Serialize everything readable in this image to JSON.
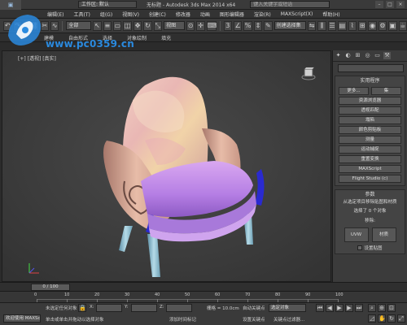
{
  "titlebar": {
    "workspace": "工作区: 默认",
    "document": "无标题 - Autodesk 3ds Max 2014 x64",
    "search_placeholder": "键入关键字或短语"
  },
  "menus": [
    "编辑(E)",
    "工具(T)",
    "组(G)",
    "视图(V)",
    "创建(C)",
    "修改器",
    "动画",
    "图形编辑器",
    "渲染(R)",
    "MAXScript(X)",
    "帮助(H)"
  ],
  "toolbar": {
    "selection_filter": "全部",
    "reference_coord": "视图",
    "named_selection": "创建选择集"
  },
  "ribbon": {
    "tabs": [
      "建模",
      "自由形式",
      "选择",
      "对象绘制",
      "填充"
    ]
  },
  "watermark": {
    "text": "www.pc0359.cn"
  },
  "viewport": {
    "label": "[+] [透视] [真实]"
  },
  "command_panel": {
    "rollout_title": "实用程序",
    "top_buttons": [
      "更多...",
      "集"
    ],
    "utilities": [
      "资源浏览器",
      "透视匹配",
      "塌陷",
      "颜色剪贴板",
      "测量",
      "运动捕捉",
      "重置变换",
      "MAXScript",
      "Flight Studio (c)"
    ],
    "params_title": "参数",
    "params_desc": "从选定项目移除贴图和材质",
    "selected_info": "选择了 0 个对象",
    "remove_label": "移除:",
    "uvw_button": "UVW",
    "material_button": "材质",
    "checkbox_label": "设置贴图"
  },
  "timeline": {
    "slider": "0 / 100",
    "ticks": [
      "0",
      "10",
      "20",
      "30",
      "40",
      "50",
      "60",
      "70",
      "80",
      "90",
      "100"
    ]
  },
  "statusbar": {
    "welcome": "欢迎使用 MAXSc",
    "selection_status": "未选定任何对象",
    "prompt": "单击或单击并拖动以选择对象",
    "x_label": "X:",
    "y_label": "Y:",
    "z_label": "Z:",
    "grid": "栅格 = 10.0cm",
    "auto_key": "自动关键点",
    "selected_obj": "选定对象",
    "set_key": "设置关键点",
    "key_filters": "关键点过滤器...",
    "add_time_tag": "添加时间标记"
  }
}
